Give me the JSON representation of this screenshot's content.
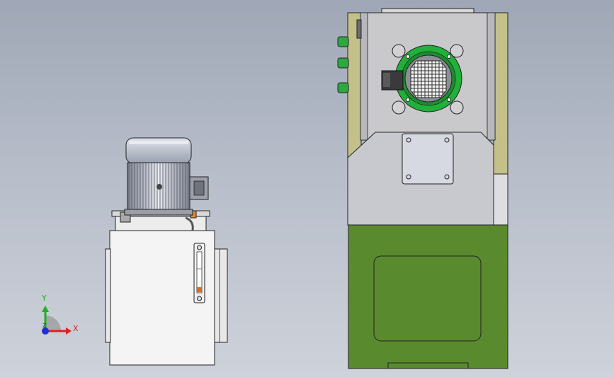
{
  "viewport": {
    "background_top": "#9fa7b6",
    "background_bottom": "#ced2da"
  },
  "triad": {
    "x_label": "X",
    "y_label": "Y",
    "z_label": "Z",
    "x_color": "#e02020",
    "y_color": "#20b020",
    "z_color": "#2030d0"
  },
  "parts": {
    "power_unit": {
      "motor_color": "#b9bdc8",
      "tank_color": "#f4f4f4"
    },
    "machine": {
      "housing_color": "#c9c9cc",
      "base_color": "#5a8a2e",
      "side_plate_color": "#c3c08a",
      "flange_color": "#21b03a",
      "button_color": "#2ea840"
    }
  }
}
